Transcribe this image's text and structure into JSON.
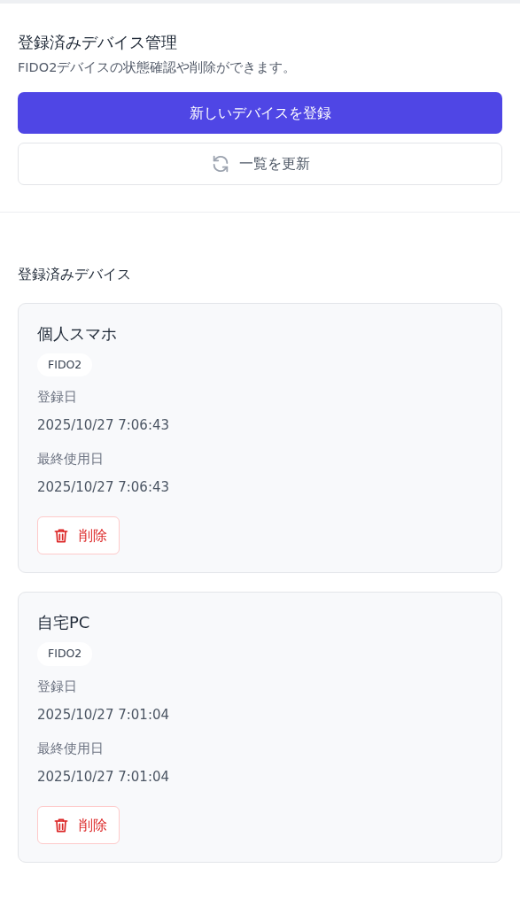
{
  "header": {
    "title": "登録済みデバイス管理",
    "description": "FIDO2デバイスの状態確認や削除ができます。",
    "register_button": "新しいデバイスを登録",
    "refresh_button": "一覧を更新"
  },
  "devices_section": {
    "title": "登録済みデバイス",
    "devices": [
      {
        "name": "個人スマホ",
        "badge": "FIDO2",
        "registered_label": "登録日",
        "registered": "2025/10/27 7:06:43",
        "last_used_label": "最終使用日",
        "last_used": "2025/10/27 7:06:43",
        "delete_button": "削除"
      },
      {
        "name": "自宅PC",
        "badge": "FIDO2",
        "registered_label": "登録日",
        "registered": "2025/10/27 7:01:04",
        "last_used_label": "最終使用日",
        "last_used": "2025/10/27 7:01:04",
        "delete_button": "削除"
      }
    ]
  }
}
